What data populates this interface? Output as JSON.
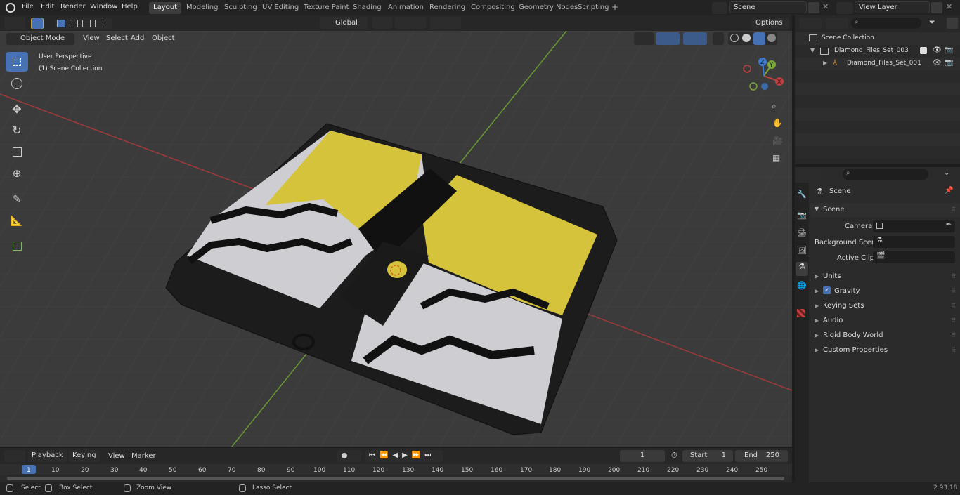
{
  "topbar": {
    "menus": [
      "File",
      "Edit",
      "Render",
      "Window",
      "Help"
    ],
    "workspaces": [
      "Layout",
      "Modeling",
      "Sculpting",
      "UV Editing",
      "Texture Paint",
      "Shading",
      "Animation",
      "Rendering",
      "Compositing",
      "Geometry Nodes",
      "Scripting"
    ],
    "active_workspace": "Layout",
    "scene": "Scene",
    "view_layer": "View Layer"
  },
  "viewport": {
    "mode": "Object Mode",
    "menus": [
      "View",
      "Select",
      "Add",
      "Object"
    ],
    "transform_orientation": "Global",
    "options": "Options",
    "perspective": "User Perspective",
    "collection": "(1) Scene Collection",
    "gizmo": {
      "x": "X",
      "y": "Y",
      "z": "Z"
    }
  },
  "outliner": {
    "root": "Scene Collection",
    "items": [
      {
        "name": "Diamond_Files_Set_003"
      },
      {
        "name": "Diamond_Files_Set_001"
      }
    ]
  },
  "properties": {
    "title": "Scene",
    "panel": "Scene",
    "fields": [
      {
        "label": "Camera"
      },
      {
        "label": "Background Scene"
      },
      {
        "label": "Active Clip"
      }
    ],
    "sections": [
      "Units",
      "Gravity",
      "Keying Sets",
      "Audio",
      "Rigid Body World",
      "Custom Properties"
    ]
  },
  "timeline": {
    "menus": [
      "Playback",
      "Keying",
      "View",
      "Marker"
    ],
    "current_frame": "1",
    "start_label": "Start",
    "start": "1",
    "end_label": "End",
    "end": "250",
    "ticks": [
      "1",
      "10",
      "20",
      "30",
      "40",
      "50",
      "60",
      "70",
      "80",
      "90",
      "100",
      "110",
      "120",
      "130",
      "140",
      "150",
      "160",
      "170",
      "180",
      "190",
      "200",
      "210",
      "220",
      "230",
      "240",
      "250"
    ]
  },
  "status": {
    "items": [
      "Select",
      "Box Select",
      "Zoom View",
      "Lasso Select"
    ],
    "version": "2.93.18"
  },
  "colors": {
    "accent": "#4672b4",
    "active_frame": "#4772b3",
    "axis_red": "#c04040",
    "axis_green": "#7aa63b",
    "yellow": "#d8c23a"
  }
}
